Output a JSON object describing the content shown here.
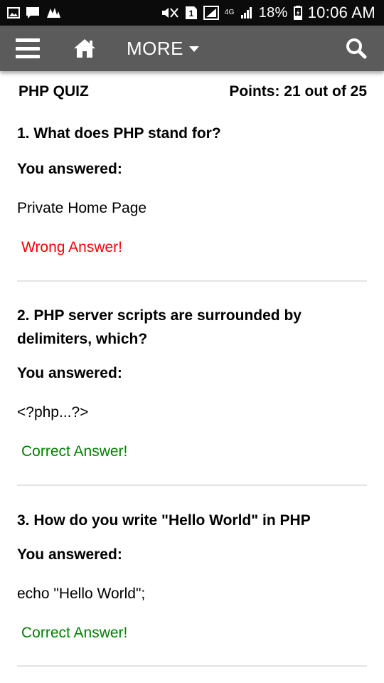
{
  "status_bar": {
    "time": "10:06 AM",
    "battery_percent": "18%",
    "network_type": "4G",
    "icons": [
      "gallery-notification-icon",
      "message-notification-icon",
      "app-notification-icon",
      "mute-icon",
      "sim-icon",
      "signal-icon",
      "signal-icon",
      "battery-charging-icon"
    ]
  },
  "app_bar": {
    "more_label": "MORE",
    "icons": [
      "hamburger-menu-icon",
      "home-icon",
      "search-icon"
    ]
  },
  "quiz": {
    "title": "PHP QUIZ",
    "points": "Points: 21 out of 25",
    "you_answered_label": "You answered:",
    "questions": [
      {
        "text": "1. What does PHP stand for?",
        "answer": "Private Home Page",
        "verdict": "Wrong Answer!",
        "correct": false
      },
      {
        "text": "2. PHP server scripts are surrounded by delimiters, which?",
        "answer": "<?php...?>",
        "verdict": "Correct Answer!",
        "correct": true
      },
      {
        "text": "3. How do you write \"Hello World\" in PHP",
        "answer": "echo \"Hello World\";",
        "verdict": "Correct Answer!",
        "correct": true
      }
    ]
  },
  "colors": {
    "wrong": "#ff0000",
    "correct": "#008000",
    "app_bar": "#5b5b5b",
    "status_bar": "#0b0b0b"
  }
}
